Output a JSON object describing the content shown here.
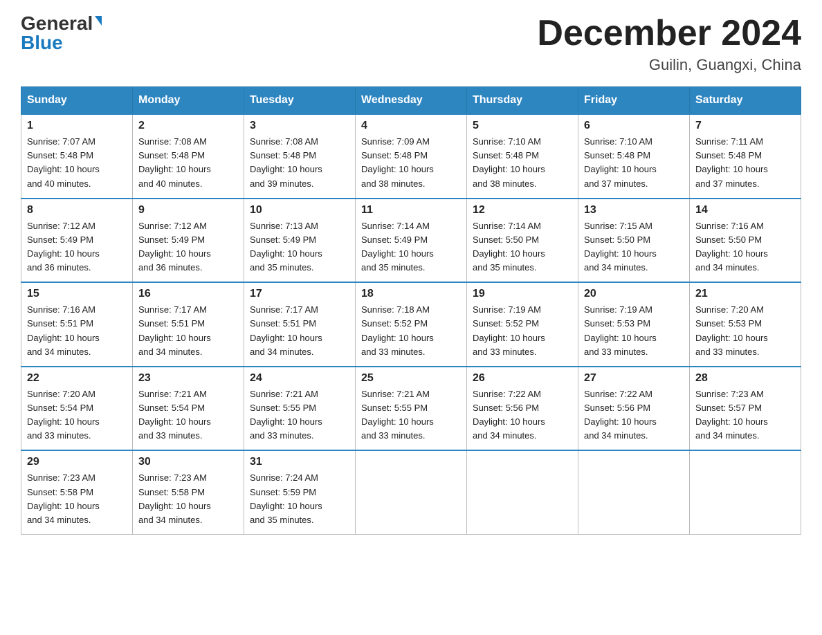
{
  "header": {
    "logo_general": "General",
    "logo_blue": "Blue",
    "month_year": "December 2024",
    "location": "Guilin, Guangxi, China"
  },
  "weekdays": [
    "Sunday",
    "Monday",
    "Tuesday",
    "Wednesday",
    "Thursday",
    "Friday",
    "Saturday"
  ],
  "weeks": [
    [
      {
        "day": "1",
        "sunrise": "7:07 AM",
        "sunset": "5:48 PM",
        "daylight": "10 hours and 40 minutes."
      },
      {
        "day": "2",
        "sunrise": "7:08 AM",
        "sunset": "5:48 PM",
        "daylight": "10 hours and 40 minutes."
      },
      {
        "day": "3",
        "sunrise": "7:08 AM",
        "sunset": "5:48 PM",
        "daylight": "10 hours and 39 minutes."
      },
      {
        "day": "4",
        "sunrise": "7:09 AM",
        "sunset": "5:48 PM",
        "daylight": "10 hours and 38 minutes."
      },
      {
        "day": "5",
        "sunrise": "7:10 AM",
        "sunset": "5:48 PM",
        "daylight": "10 hours and 38 minutes."
      },
      {
        "day": "6",
        "sunrise": "7:10 AM",
        "sunset": "5:48 PM",
        "daylight": "10 hours and 37 minutes."
      },
      {
        "day": "7",
        "sunrise": "7:11 AM",
        "sunset": "5:48 PM",
        "daylight": "10 hours and 37 minutes."
      }
    ],
    [
      {
        "day": "8",
        "sunrise": "7:12 AM",
        "sunset": "5:49 PM",
        "daylight": "10 hours and 36 minutes."
      },
      {
        "day": "9",
        "sunrise": "7:12 AM",
        "sunset": "5:49 PM",
        "daylight": "10 hours and 36 minutes."
      },
      {
        "day": "10",
        "sunrise": "7:13 AM",
        "sunset": "5:49 PM",
        "daylight": "10 hours and 35 minutes."
      },
      {
        "day": "11",
        "sunrise": "7:14 AM",
        "sunset": "5:49 PM",
        "daylight": "10 hours and 35 minutes."
      },
      {
        "day": "12",
        "sunrise": "7:14 AM",
        "sunset": "5:50 PM",
        "daylight": "10 hours and 35 minutes."
      },
      {
        "day": "13",
        "sunrise": "7:15 AM",
        "sunset": "5:50 PM",
        "daylight": "10 hours and 34 minutes."
      },
      {
        "day": "14",
        "sunrise": "7:16 AM",
        "sunset": "5:50 PM",
        "daylight": "10 hours and 34 minutes."
      }
    ],
    [
      {
        "day": "15",
        "sunrise": "7:16 AM",
        "sunset": "5:51 PM",
        "daylight": "10 hours and 34 minutes."
      },
      {
        "day": "16",
        "sunrise": "7:17 AM",
        "sunset": "5:51 PM",
        "daylight": "10 hours and 34 minutes."
      },
      {
        "day": "17",
        "sunrise": "7:17 AM",
        "sunset": "5:51 PM",
        "daylight": "10 hours and 34 minutes."
      },
      {
        "day": "18",
        "sunrise": "7:18 AM",
        "sunset": "5:52 PM",
        "daylight": "10 hours and 33 minutes."
      },
      {
        "day": "19",
        "sunrise": "7:19 AM",
        "sunset": "5:52 PM",
        "daylight": "10 hours and 33 minutes."
      },
      {
        "day": "20",
        "sunrise": "7:19 AM",
        "sunset": "5:53 PM",
        "daylight": "10 hours and 33 minutes."
      },
      {
        "day": "21",
        "sunrise": "7:20 AM",
        "sunset": "5:53 PM",
        "daylight": "10 hours and 33 minutes."
      }
    ],
    [
      {
        "day": "22",
        "sunrise": "7:20 AM",
        "sunset": "5:54 PM",
        "daylight": "10 hours and 33 minutes."
      },
      {
        "day": "23",
        "sunrise": "7:21 AM",
        "sunset": "5:54 PM",
        "daylight": "10 hours and 33 minutes."
      },
      {
        "day": "24",
        "sunrise": "7:21 AM",
        "sunset": "5:55 PM",
        "daylight": "10 hours and 33 minutes."
      },
      {
        "day": "25",
        "sunrise": "7:21 AM",
        "sunset": "5:55 PM",
        "daylight": "10 hours and 33 minutes."
      },
      {
        "day": "26",
        "sunrise": "7:22 AM",
        "sunset": "5:56 PM",
        "daylight": "10 hours and 34 minutes."
      },
      {
        "day": "27",
        "sunrise": "7:22 AM",
        "sunset": "5:56 PM",
        "daylight": "10 hours and 34 minutes."
      },
      {
        "day": "28",
        "sunrise": "7:23 AM",
        "sunset": "5:57 PM",
        "daylight": "10 hours and 34 minutes."
      }
    ],
    [
      {
        "day": "29",
        "sunrise": "7:23 AM",
        "sunset": "5:58 PM",
        "daylight": "10 hours and 34 minutes."
      },
      {
        "day": "30",
        "sunrise": "7:23 AM",
        "sunset": "5:58 PM",
        "daylight": "10 hours and 34 minutes."
      },
      {
        "day": "31",
        "sunrise": "7:24 AM",
        "sunset": "5:59 PM",
        "daylight": "10 hours and 35 minutes."
      },
      null,
      null,
      null,
      null
    ]
  ],
  "labels": {
    "sunrise": "Sunrise:",
    "sunset": "Sunset:",
    "daylight": "Daylight:"
  }
}
